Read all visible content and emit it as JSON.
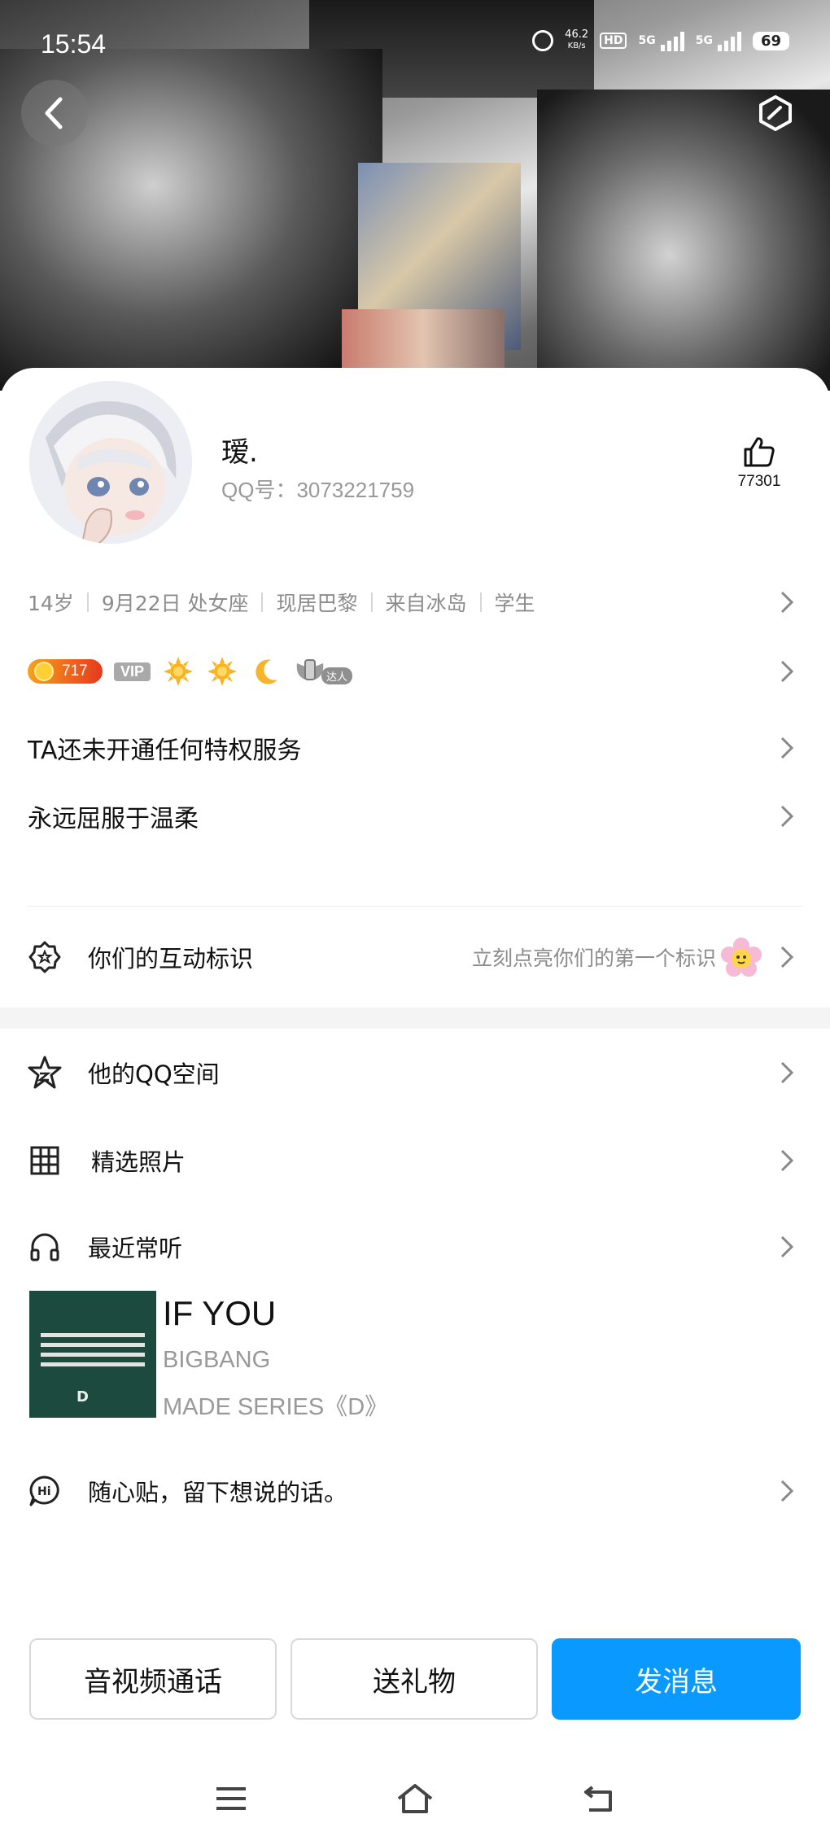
{
  "status_bar": {
    "time": "15:54",
    "net_speed_value": "46.2",
    "net_speed_unit": "KB/s",
    "hd_label": "HD",
    "net_1": "5G",
    "net_2": "5G",
    "battery": "69"
  },
  "profile": {
    "nickname": "瑷.",
    "qq_number": "QQ号：3073221759",
    "like_count": "77301"
  },
  "info_items": [
    "14岁",
    "9月22日  处女座",
    "现居巴黎",
    "来自冰岛",
    "学生"
  ],
  "badges": {
    "level": "717",
    "vip": "VIP",
    "daren": "达人"
  },
  "privilege_text": "TA还未开通任何特权服务",
  "signature": "永远屈服于温柔",
  "interaction": {
    "label": "你们的互动标识",
    "hint": "立刻点亮你们的第一个标识"
  },
  "menu": {
    "qzone": "他的QQ空间",
    "photos": "精选照片",
    "music": "最近常听",
    "note": "随心贴，留下想说的话。"
  },
  "song": {
    "title": "IF YOU",
    "artist": "BIGBANG",
    "album": "MADE SERIES《D》",
    "cover_letter": "D"
  },
  "actions": {
    "call": "音视频通话",
    "gift": "送礼物",
    "message": "发消息"
  },
  "colors": {
    "accent": "#0a99ff",
    "muted_text": "#8c8c8c"
  }
}
